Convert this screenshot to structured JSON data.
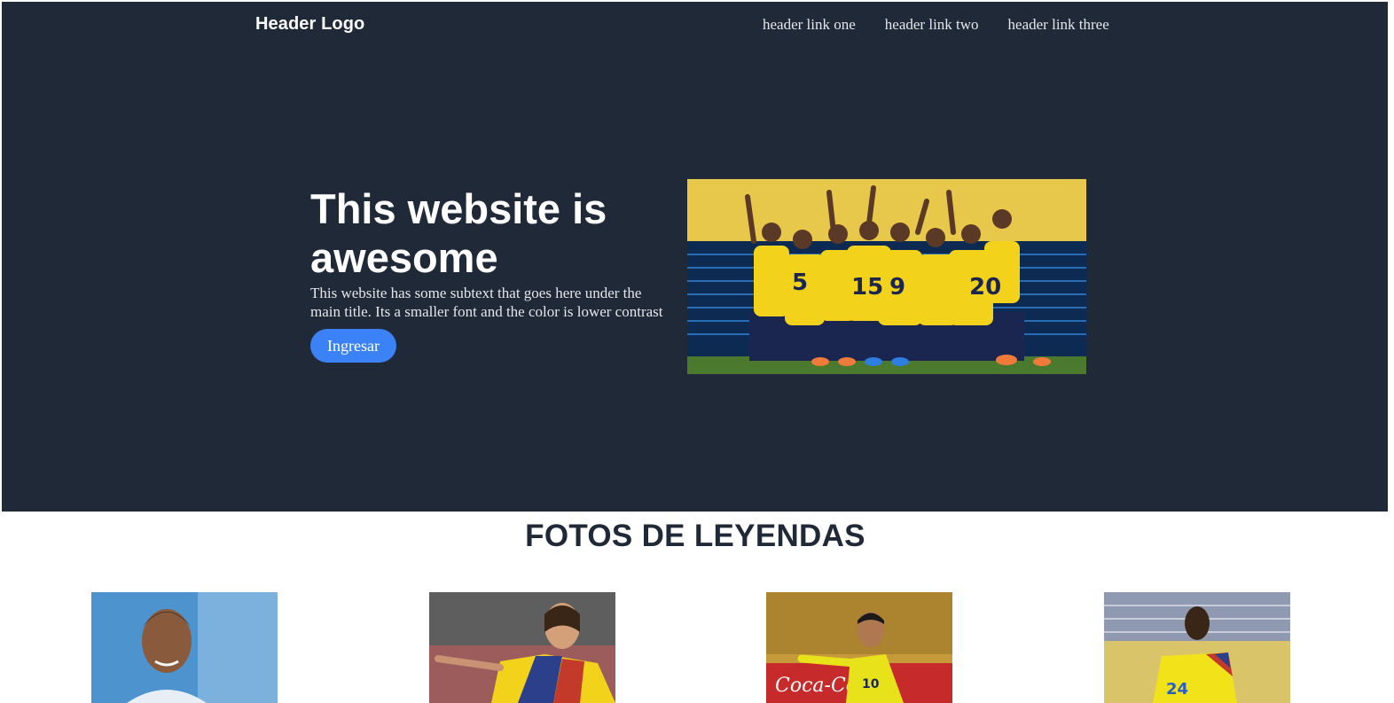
{
  "header": {
    "logo": "Header Logo",
    "links": [
      "header link one",
      "header link two",
      "header link three"
    ]
  },
  "hero": {
    "title": "This website is awesome",
    "subtitle": "This website has some subtext that goes here under the main title. Its a smaller font and the color is lower contrast",
    "button_label": "Ingresar",
    "image": "team-celebration-photo"
  },
  "legends": {
    "title": "FOTOS DE LEYENDAS",
    "photos": [
      "legend-photo-1",
      "legend-photo-2",
      "legend-photo-3",
      "legend-photo-4"
    ]
  },
  "colors": {
    "hero_bg": "#1f2937",
    "button": "#3b82f6",
    "section_title": "#1f2937"
  }
}
